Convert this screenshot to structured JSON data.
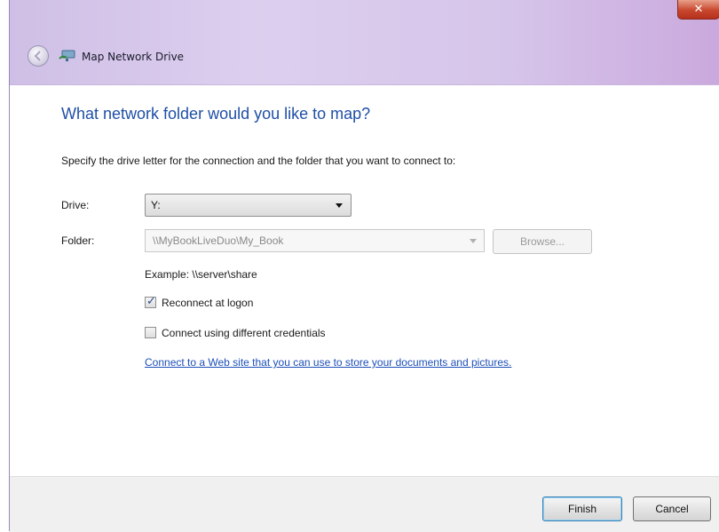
{
  "window": {
    "title": "Map Network Drive",
    "close_label": "✕"
  },
  "main": {
    "heading": "What network folder would you like to map?",
    "instruction": "Specify the drive letter for the connection and the folder that you want to connect to:",
    "drive_label": "Drive:",
    "drive_value": "Y:",
    "folder_label": "Folder:",
    "folder_value": "\\\\MyBookLiveDuo\\My_Book",
    "browse_label": "Browse...",
    "example_text": "Example: \\\\server\\share",
    "reconnect_label": "Reconnect at logon",
    "reconnect_checked": true,
    "credentials_label": "Connect using different credentials",
    "credentials_checked": false,
    "link_text": "Connect to a Web site that you can use to store your documents and pictures."
  },
  "footer": {
    "finish_label": "Finish",
    "cancel_label": "Cancel"
  },
  "icons": {
    "back": "back-arrow-icon",
    "title": "network-drive-icon",
    "close": "close-icon"
  },
  "colors": {
    "heading": "#1f4fa6",
    "link": "#1c4fb8",
    "titlebar": "#d6c5ea",
    "close": "#c8472e"
  }
}
